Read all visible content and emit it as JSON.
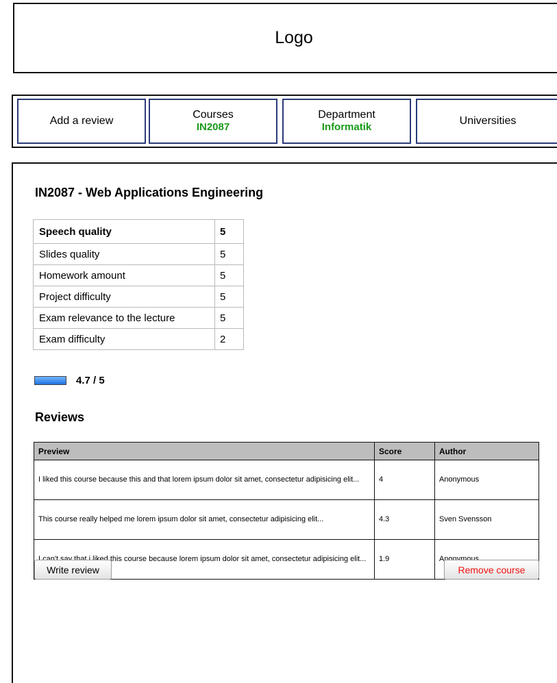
{
  "header": {
    "logo_text": "Logo"
  },
  "nav": {
    "items": [
      {
        "label": "Add a review",
        "sub": ""
      },
      {
        "label": "Courses",
        "sub": "IN2087"
      },
      {
        "label": "Department",
        "sub": "Informatik"
      },
      {
        "label": "Universities",
        "sub": ""
      }
    ]
  },
  "course": {
    "title": "IN2087 - Web Applications Engineering",
    "ratings": [
      {
        "label": "Speech quality",
        "value": "5"
      },
      {
        "label": "Slides quality",
        "value": "5"
      },
      {
        "label": "Homework amount",
        "value": "5"
      },
      {
        "label": "Project difficulty",
        "value": "5"
      },
      {
        "label": "Exam relevance to the lecture",
        "value": "5"
      },
      {
        "label": "Exam difficulty",
        "value": "2"
      }
    ],
    "overall_text": "4.7 / 5",
    "overall_value": 4.7,
    "overall_max": 5
  },
  "reviews": {
    "title": "Reviews",
    "columns": {
      "preview": "Preview",
      "score": "Score",
      "author": "Author"
    },
    "rows": [
      {
        "preview": "I liked this course because this and that lorem ipsum dolor sit amet, consectetur adipisicing elit...",
        "score": "4",
        "author": "Anonymous"
      },
      {
        "preview": "This course really helped me lorem ipsum dolor sit amet, consectetur adipisicing elit...",
        "score": "4.3",
        "author": "Sven Svensson"
      },
      {
        "preview": "I can't say that i liked this course because lorem ipsum dolor sit amet, consectetur adipisicing elit...",
        "score": "1.9",
        "author": "Anonymous"
      }
    ]
  },
  "actions": {
    "write_label": "Write review",
    "remove_label": "Remove course"
  },
  "colors": {
    "nav_border": "#2b3a78",
    "nav_sub_text": "#1a9a1a",
    "remove_text": "#ee1111",
    "score_bar": "#1f73de",
    "table_header_bg": "#bdbdbd"
  }
}
